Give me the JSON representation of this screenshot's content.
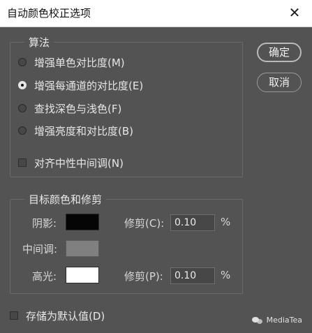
{
  "window": {
    "title": "自动颜色校正选项",
    "close": "✕"
  },
  "algorithm": {
    "legend": "算法",
    "options": [
      {
        "label": "增强单色对比度(M)",
        "checked": false
      },
      {
        "label": "增强每通道的对比度(E)",
        "checked": true
      },
      {
        "label": "查找深色与浅色(F)",
        "checked": false
      },
      {
        "label": "增强亮度和对比度(B)",
        "checked": false
      }
    ],
    "snap_neutral": {
      "label": "对齐中性中间调(N)",
      "checked": false
    }
  },
  "buttons": {
    "ok": "确定",
    "cancel": "取消"
  },
  "target": {
    "legend": "目标颜色和修剪",
    "shadows_label": "阴影:",
    "shadows_color": "#050505",
    "midtones_label": "中间调:",
    "midtones_color": "#808080",
    "highlights_label": "高光:",
    "highlights_color": "#ffffff",
    "clip_shadow_label": "修剪(C):",
    "clip_shadow_value": "0.10",
    "clip_highlight_label": "修剪(P):",
    "clip_highlight_value": "0.10",
    "percent": "%"
  },
  "save_default": {
    "label": "存储为默认值(D)",
    "checked": false
  },
  "watermark": {
    "text": "MediaTea"
  }
}
